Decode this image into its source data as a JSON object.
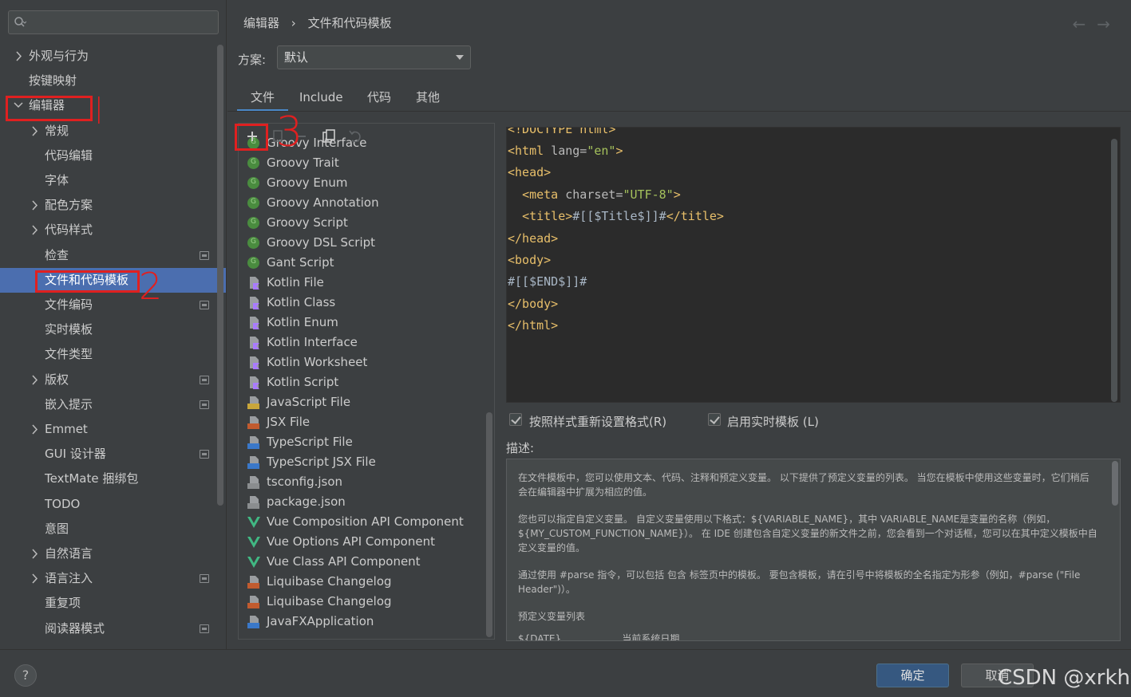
{
  "search": {
    "placeholder": ""
  },
  "sidebar": {
    "items": [
      {
        "label": "外观与行为",
        "chevron": "right",
        "indent": 0,
        "badge": false
      },
      {
        "label": "按键映射",
        "chevron": "none",
        "indent": 0,
        "badge": false
      },
      {
        "label": "编辑器",
        "chevron": "down",
        "indent": 0,
        "badge": false
      },
      {
        "label": "常规",
        "chevron": "right",
        "indent": 1,
        "badge": false
      },
      {
        "label": "代码编辑",
        "chevron": "none",
        "indent": 1,
        "badge": false
      },
      {
        "label": "字体",
        "chevron": "none",
        "indent": 1,
        "badge": false
      },
      {
        "label": "配色方案",
        "chevron": "right",
        "indent": 1,
        "badge": false
      },
      {
        "label": "代码样式",
        "chevron": "right",
        "indent": 1,
        "badge": false
      },
      {
        "label": "检查",
        "chevron": "none",
        "indent": 1,
        "badge": true
      },
      {
        "label": "文件和代码模板",
        "chevron": "none",
        "indent": 1,
        "badge": false,
        "selected": true
      },
      {
        "label": "文件编码",
        "chevron": "none",
        "indent": 1,
        "badge": true
      },
      {
        "label": "实时模板",
        "chevron": "none",
        "indent": 1,
        "badge": false
      },
      {
        "label": "文件类型",
        "chevron": "none",
        "indent": 1,
        "badge": false
      },
      {
        "label": "版权",
        "chevron": "right",
        "indent": 1,
        "badge": true
      },
      {
        "label": "嵌入提示",
        "chevron": "none",
        "indent": 1,
        "badge": true
      },
      {
        "label": "Emmet",
        "chevron": "right",
        "indent": 1,
        "badge": false
      },
      {
        "label": "GUI 设计器",
        "chevron": "none",
        "indent": 1,
        "badge": true
      },
      {
        "label": "TextMate 捆绑包",
        "chevron": "none",
        "indent": 1,
        "badge": false
      },
      {
        "label": "TODO",
        "chevron": "none",
        "indent": 1,
        "badge": false
      },
      {
        "label": "意图",
        "chevron": "none",
        "indent": 1,
        "badge": false
      },
      {
        "label": "自然语言",
        "chevron": "right",
        "indent": 1,
        "badge": false
      },
      {
        "label": "语言注入",
        "chevron": "right",
        "indent": 1,
        "badge": true
      },
      {
        "label": "重复项",
        "chevron": "none",
        "indent": 1,
        "badge": false
      },
      {
        "label": "阅读器模式",
        "chevron": "none",
        "indent": 1,
        "badge": true
      }
    ]
  },
  "breadcrumb": {
    "parent": "编辑器",
    "separator": "›",
    "current": "文件和代码模板"
  },
  "scheme": {
    "label": "方案:",
    "value": "默认"
  },
  "tabs": [
    {
      "label": "文件",
      "active": true
    },
    {
      "label": "Include",
      "active": false
    },
    {
      "label": "代码",
      "active": false
    },
    {
      "label": "其他",
      "active": false
    }
  ],
  "templates": [
    {
      "label": "Groovy Interface",
      "icon": "groovy-icon"
    },
    {
      "label": "Groovy Trait",
      "icon": "groovy-icon"
    },
    {
      "label": "Groovy Enum",
      "icon": "groovy-icon"
    },
    {
      "label": "Groovy Annotation",
      "icon": "groovy-icon"
    },
    {
      "label": "Groovy Script",
      "icon": "groovy-icon"
    },
    {
      "label": "Groovy DSL Script",
      "icon": "groovy-icon"
    },
    {
      "label": "Gant Script",
      "icon": "groovy-icon"
    },
    {
      "label": "Kotlin File",
      "icon": "kotlin-icon"
    },
    {
      "label": "Kotlin Class",
      "icon": "kotlin-icon"
    },
    {
      "label": "Kotlin Enum",
      "icon": "kotlin-icon"
    },
    {
      "label": "Kotlin Interface",
      "icon": "kotlin-icon"
    },
    {
      "label": "Kotlin Worksheet",
      "icon": "kotlin-icon"
    },
    {
      "label": "Kotlin Script",
      "icon": "kotlin-icon"
    },
    {
      "label": "JavaScript File",
      "icon": "js-file-icon",
      "tag": "JS",
      "tagColor": "#c9a63a"
    },
    {
      "label": "JSX File",
      "icon": "jsx-file-icon",
      "tag": "JSX",
      "tagColor": "#c15b2f"
    },
    {
      "label": "TypeScript File",
      "icon": "ts-file-icon",
      "tag": "TS",
      "tagColor": "#3a78c9"
    },
    {
      "label": "TypeScript JSX File",
      "icon": "tsx-file-icon",
      "tag": "TSX",
      "tagColor": "#3a78c9"
    },
    {
      "label": "tsconfig.json",
      "icon": "json-file-icon",
      "tag": "{}",
      "tagColor": "#8a8d8f"
    },
    {
      "label": "package.json",
      "icon": "json-file-icon",
      "tag": "{}",
      "tagColor": "#8a8d8f"
    },
    {
      "label": "Vue Composition API Component",
      "icon": "vue-icon"
    },
    {
      "label": "Vue Options API Component",
      "icon": "vue-icon"
    },
    {
      "label": "Vue Class API Component",
      "icon": "vue-icon"
    },
    {
      "label": "Liquibase Changelog",
      "icon": "xml-file-icon",
      "tag": "<>",
      "tagColor": "#c15b2f"
    },
    {
      "label": "Liquibase Changelog",
      "icon": "yml-file-icon",
      "tag": "YML",
      "tagColor": "#c15b2f"
    },
    {
      "label": "JavaFXApplication",
      "icon": "java-file-icon",
      "tag": "J",
      "tagColor": "#3a78c9"
    }
  ],
  "editor": {
    "lines": [
      "<!DOCTYPE html>",
      "<html lang=\"en\">",
      "<head>",
      "  <meta charset=\"UTF-8\">",
      "  <title>#[[$Title$]]#</title>",
      "</head>",
      "<body>",
      "#[[$END$]]#",
      "</body>",
      "</html>"
    ]
  },
  "options": {
    "reformat": "按照样式重新设置格式(R)",
    "live_templates": "启用实时模板 (L)"
  },
  "description": {
    "label": "描述:",
    "paragraphs": [
      "在文件模板中，您可以使用文本、代码、注释和预定义变量。 以下提供了预定义变量的列表。 当您在模板中使用这些变量时，它们稍后会在编辑器中扩展为相应的值。",
      "您也可以指定自定义变量。 自定义变量使用以下格式：${VARIABLE_NAME}，其中 VARIABLE_NAME是变量的名称（例如，${MY_CUSTOM_FUNCTION_NAME}）。 在 IDE 创建包含自定义变量的新文件之前，您会看到一个对话框，您可以在其中定义模板中自定义变量的值。",
      "通过使用 #parse 指令，可以包括 包含 标签页中的模板。 要包含模板，请在引号中将模板的全名指定为形参（例如，#parse (\"File Header\")）。",
      "预定义变量列表",
      "${DATE}                    当前系统日期"
    ]
  },
  "footer": {
    "help": "?",
    "ok": "确定",
    "cancel": "取消",
    "watermark": "CSDN @xrkhy"
  },
  "annotations": {
    "mark1": "|",
    "mark2": "2",
    "mark3": "3"
  },
  "colors": {
    "accent": "#4b6eaf",
    "annotation": "#e02020",
    "ok_button": "#365880"
  }
}
